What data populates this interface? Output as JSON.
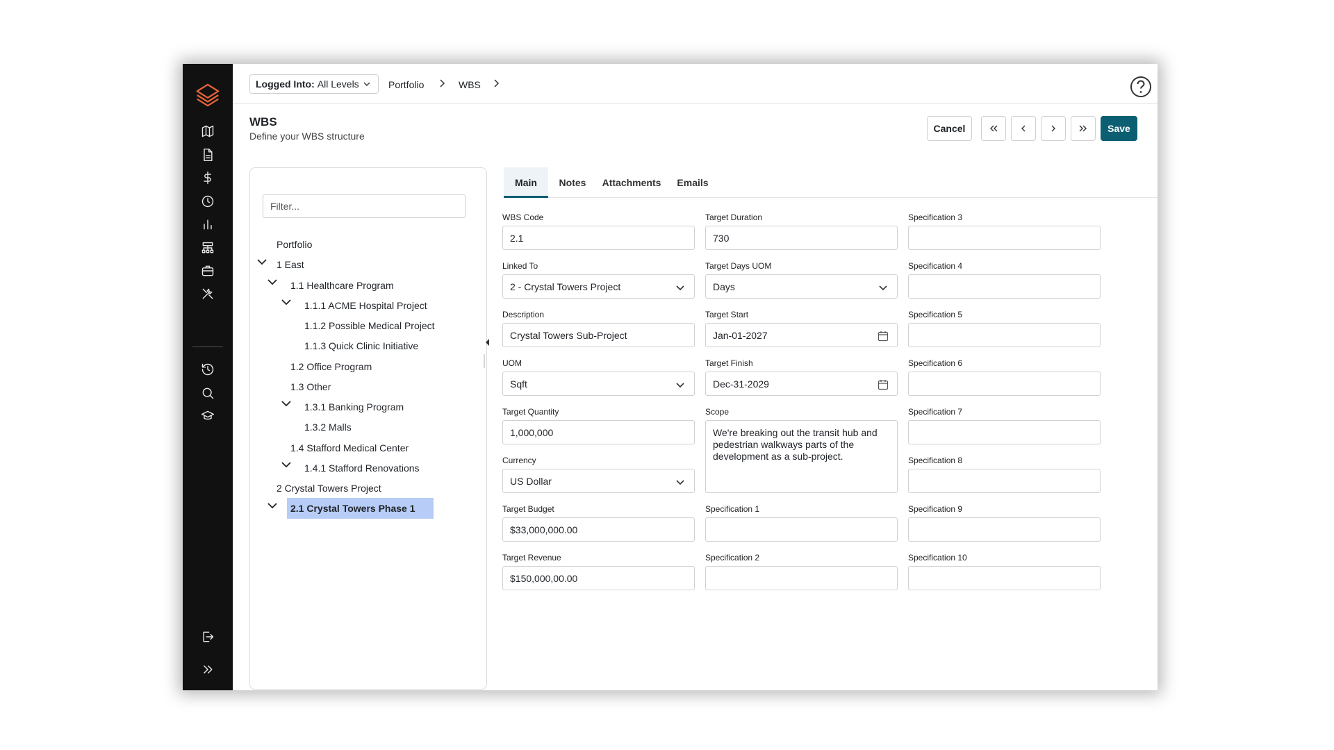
{
  "header": {
    "logged_key": "Logged Into:",
    "logged_value": "All Levels",
    "breadcrumbs": [
      "Portfolio",
      "WBS"
    ]
  },
  "page": {
    "title": "WBS",
    "subtitle": "Define your WBS structure"
  },
  "toolbar": {
    "cancel_label": "Cancel",
    "save_label": "Save",
    "icons": [
      "first-icon",
      "previous-icon",
      "next-icon",
      "last-icon"
    ]
  },
  "rail": {
    "icons": [
      "map-icon",
      "document-icon",
      "dollar-icon",
      "clock-icon",
      "bar-chart-icon",
      "hierarchy-icon",
      "briefcase-icon",
      "tools-icon",
      "history-icon",
      "search-icon",
      "graduation-cap-icon",
      "logout-icon",
      "expand-icon"
    ]
  },
  "tree": {
    "filter_placeholder": "Filter...",
    "nodes": [
      {
        "label": "Portfolio"
      },
      {
        "label": "1 East"
      },
      {
        "label": "1.1 Healthcare Program"
      },
      {
        "label": "1.1.1 ACME Hospital Project"
      },
      {
        "label": "1.1.2 Possible Medical Project"
      },
      {
        "label": "1.1.3 Quick Clinic Initiative"
      },
      {
        "label": "1.2 Office Program"
      },
      {
        "label": "1.3 Other"
      },
      {
        "label": "1.3.1 Banking Program"
      },
      {
        "label": "1.3.2 Malls"
      },
      {
        "label": "1.4 Stafford Medical Center"
      },
      {
        "label": "1.4.1 Stafford Renovations"
      },
      {
        "label": "2 Crystal Towers Project"
      },
      {
        "label": "2.1 Crystal Towers Phase 1",
        "selected": true
      }
    ]
  },
  "tabs": [
    "Main",
    "Notes",
    "Attachments",
    "Emails"
  ],
  "form": {
    "wbs_code": {
      "label": "WBS Code",
      "value": "2.1"
    },
    "linked_to": {
      "label": "Linked To",
      "value": "2 - Crystal Towers Project"
    },
    "description": {
      "label": "Description",
      "value": "Crystal Towers Sub-Project"
    },
    "uom": {
      "label": "UOM",
      "value": "Sqft"
    },
    "target_quantity": {
      "label": "Target Quantity",
      "value": "1,000,000"
    },
    "currency": {
      "label": "Currency",
      "value": "US Dollar"
    },
    "target_budget": {
      "label": "Target Budget",
      "value": "$33,000,000.00"
    },
    "target_revenue": {
      "label": "Target Revenue",
      "value": "$150,000,00.00"
    },
    "target_duration": {
      "label": "Target Duration",
      "value": "730"
    },
    "target_days_uom": {
      "label": "Target Days UOM",
      "value": "Days"
    },
    "target_start": {
      "label": "Target Start",
      "value": "Jan-01-2027"
    },
    "target_finish": {
      "label": "Target Finish",
      "value": "Dec-31-2029"
    },
    "scope": {
      "label": "Scope",
      "value": "We're breaking out the transit hub and pedestrian walkways parts of the development as a sub-project."
    },
    "spec1": {
      "label": "Specification 1",
      "value": ""
    },
    "spec2": {
      "label": "Specification 2",
      "value": ""
    },
    "spec3": {
      "label": "Specification 3",
      "value": ""
    },
    "spec4": {
      "label": "Specification 4",
      "value": ""
    },
    "spec5": {
      "label": "Specification 5",
      "value": ""
    },
    "spec6": {
      "label": "Specification 6",
      "value": ""
    },
    "spec7": {
      "label": "Specification 7",
      "value": ""
    },
    "spec8": {
      "label": "Specification 8",
      "value": ""
    },
    "spec9": {
      "label": "Specification 9",
      "value": ""
    },
    "spec10": {
      "label": "Specification 10",
      "value": ""
    }
  },
  "colors": {
    "accent": "#0c5f73",
    "selected_row": "#b7cdf7",
    "logo_orange": "#e8643a"
  }
}
